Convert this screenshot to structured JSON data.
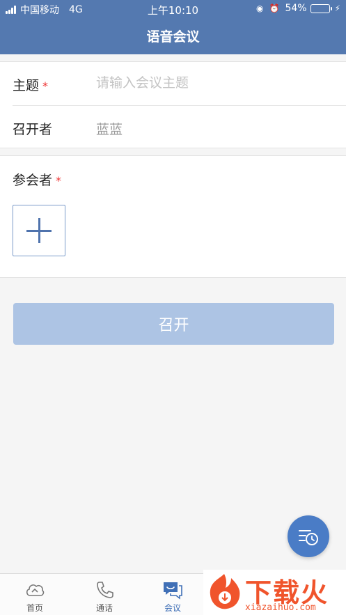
{
  "status_bar": {
    "carrier": "中国移动",
    "network": "4G",
    "time": "上午10:10",
    "battery_percent": "54%",
    "battery_level": 0.54,
    "battery_color": "#66d36e"
  },
  "header": {
    "title": "语音会议",
    "background": "#5479b0"
  },
  "form": {
    "subject_label": "主题",
    "subject_required": "*",
    "subject_placeholder": "请输入会议主题",
    "host_label": "召开者",
    "host_value": "蓝蓝",
    "attendees_label": "参会者",
    "attendees_required": "*"
  },
  "open_button": {
    "label": "召开",
    "color": "#adc4e4"
  },
  "fab": {
    "icon": "history-list-clock-icon",
    "color": "#4a7cc6"
  },
  "tabbar": {
    "active_color": "#3f6fb6",
    "items": [
      {
        "label": "首页",
        "icon": "cloud-link-icon"
      },
      {
        "label": "通话",
        "icon": "phone-icon"
      },
      {
        "label": "会议",
        "icon": "chat-bubbles-icon",
        "active": true
      }
    ]
  },
  "watermark": {
    "title": "下载火",
    "subtitle": "xiazaihuo.com",
    "icon": "flame-download-icon"
  }
}
